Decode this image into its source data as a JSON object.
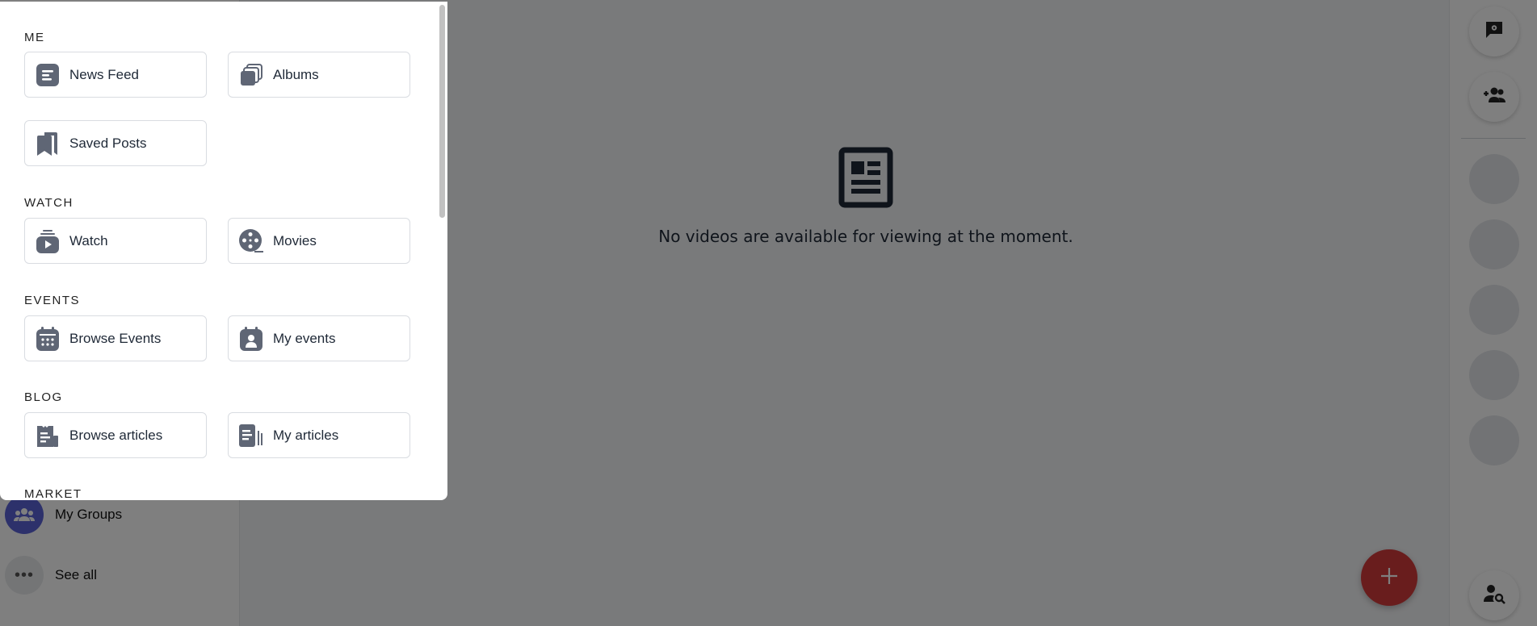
{
  "sidebar": {
    "items": [
      {
        "label": "My Groups",
        "icon": "groups-icon"
      },
      {
        "label": "See all",
        "icon": "more-dots-icon",
        "glyph": "•••"
      }
    ]
  },
  "main": {
    "empty_state": {
      "icon": "article-icon",
      "text": "No videos are available for viewing at the moment."
    }
  },
  "fab": {
    "icon": "plus-icon"
  },
  "menu": {
    "sections": [
      {
        "title": "ME",
        "items": [
          {
            "label": "News Feed",
            "icon": "news-feed-icon"
          },
          {
            "label": "Albums",
            "icon": "albums-icon"
          },
          {
            "label": "Saved Posts",
            "icon": "bookmark-icon"
          }
        ]
      },
      {
        "title": "WATCH",
        "items": [
          {
            "label": "Watch",
            "icon": "watch-video-icon"
          },
          {
            "label": "Movies",
            "icon": "movie-reel-icon"
          }
        ]
      },
      {
        "title": "EVENTS",
        "items": [
          {
            "label": "Browse Events",
            "icon": "calendar-icon"
          },
          {
            "label": "My events",
            "icon": "calendar-user-icon"
          }
        ]
      },
      {
        "title": "BLOG",
        "items": [
          {
            "label": "Browse articles",
            "icon": "articles-icon"
          },
          {
            "label": "My articles",
            "icon": "my-articles-icon"
          }
        ]
      },
      {
        "title": "MARKET",
        "items": []
      }
    ]
  },
  "colors": {
    "icon_gray": "#5f6675",
    "fab_red": "#d33a3a",
    "groups_avatar": "#5b63d6"
  }
}
